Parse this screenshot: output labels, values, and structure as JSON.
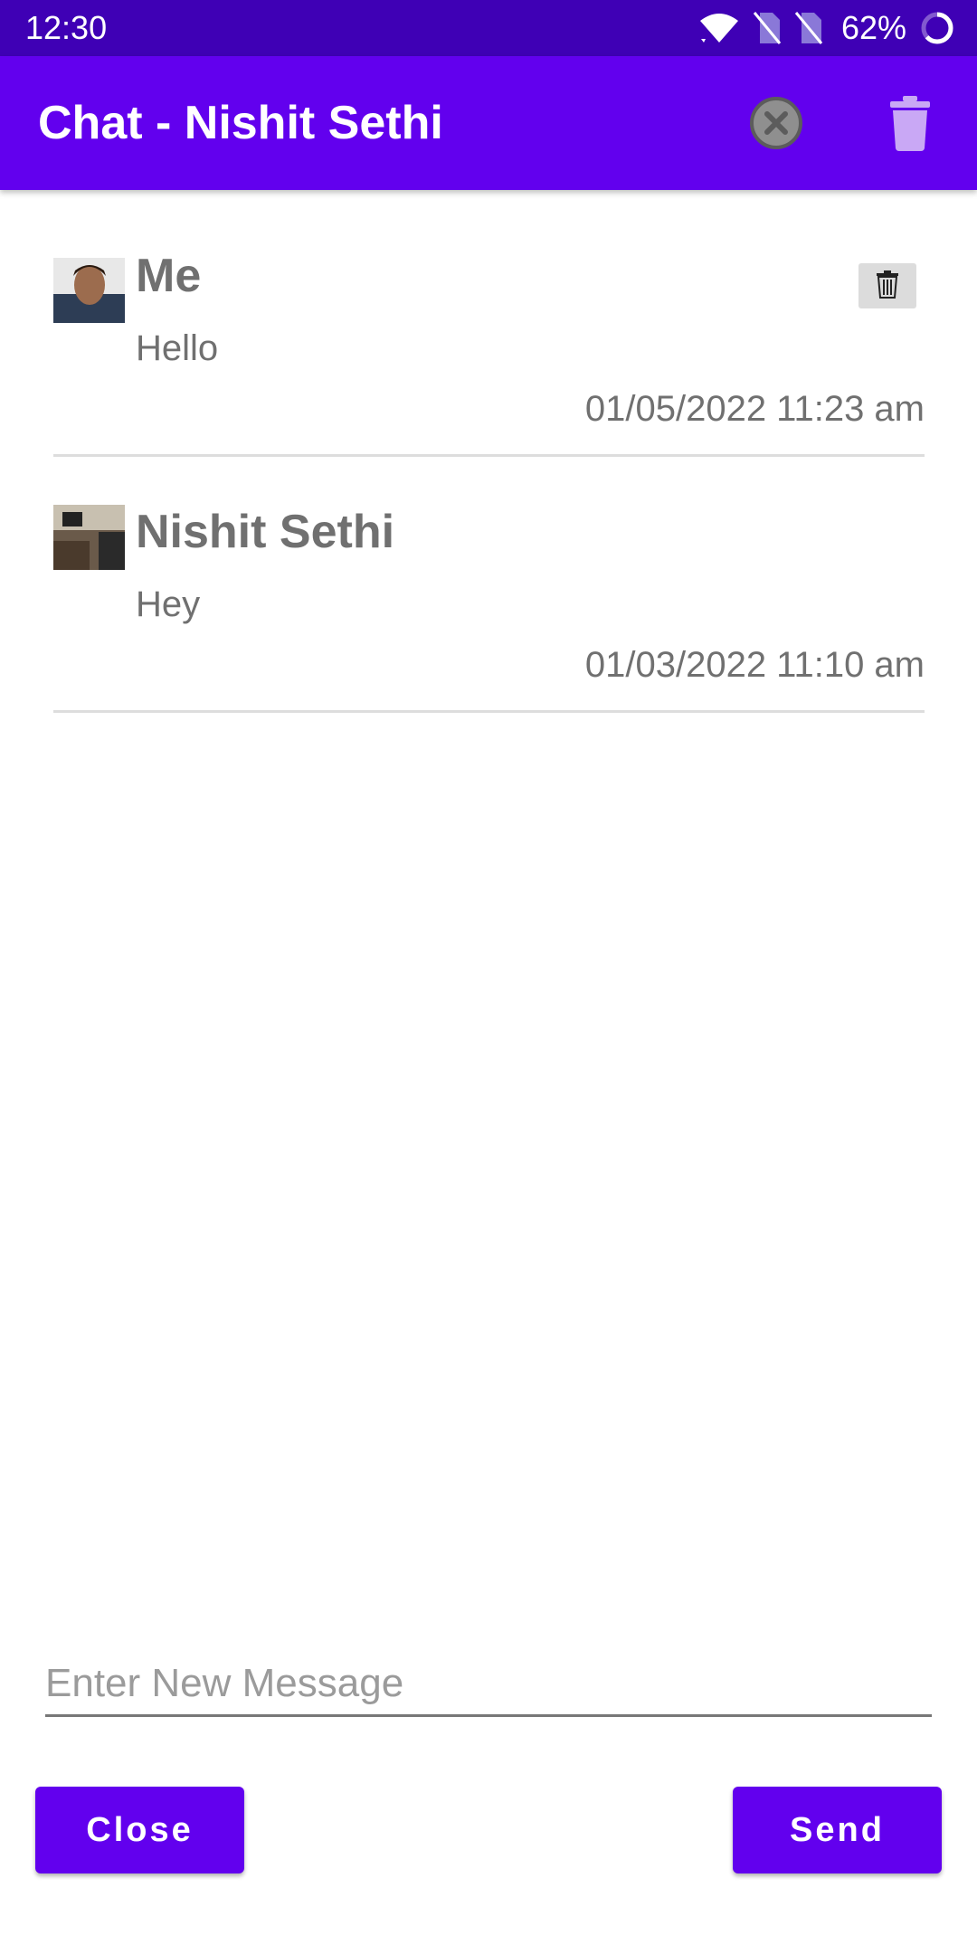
{
  "status_bar": {
    "time": "12:30",
    "battery": "62%"
  },
  "app_bar": {
    "title": "Chat - Nishit Sethi",
    "icons": [
      "cancel-icon",
      "trash-icon"
    ],
    "color": "#6200ee"
  },
  "messages": [
    {
      "sender": "Me",
      "text": "Hello",
      "time": "01/05/2022 11:23 am",
      "deletable": true
    },
    {
      "sender": "Nishit Sethi",
      "text": "Hey",
      "time": "01/03/2022 11:10 am",
      "deletable": false
    }
  ],
  "composer": {
    "placeholder": "Enter New Message",
    "value": ""
  },
  "buttons": {
    "close_label": "Close",
    "send_label": "Send"
  }
}
